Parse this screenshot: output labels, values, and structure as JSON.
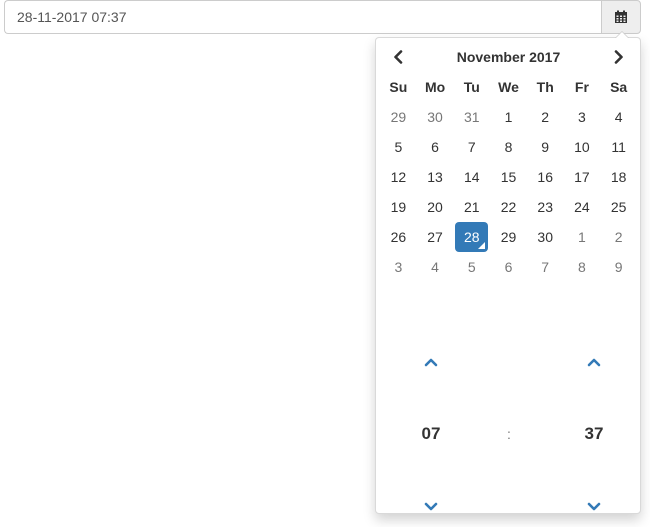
{
  "input": {
    "value": "28-11-2017 07:37"
  },
  "icons": {
    "calendar": "calendar-icon",
    "prev": "chevron-left-icon",
    "next": "chevron-right-icon",
    "up": "chevron-up-icon",
    "down": "chevron-down-icon"
  },
  "colors": {
    "accent": "#337ab7",
    "muted": "#777777",
    "text": "#333333"
  },
  "calendar": {
    "month_label": "November 2017",
    "weekdays": [
      "Su",
      "Mo",
      "Tu",
      "We",
      "Th",
      "Fr",
      "Sa"
    ],
    "weeks": [
      [
        "29",
        "30",
        "31",
        "1",
        "2",
        "3",
        "4"
      ],
      [
        "5",
        "6",
        "7",
        "8",
        "9",
        "10",
        "11"
      ],
      [
        "12",
        "13",
        "14",
        "15",
        "16",
        "17",
        "18"
      ],
      [
        "19",
        "20",
        "21",
        "22",
        "23",
        "24",
        "25"
      ],
      [
        "26",
        "27",
        "28",
        "29",
        "30",
        "1",
        "2"
      ],
      [
        "3",
        "4",
        "5",
        "6",
        "7",
        "8",
        "9"
      ]
    ],
    "selected_day": "28"
  },
  "time": {
    "hour": "07",
    "separator": ":",
    "minute": "37"
  }
}
